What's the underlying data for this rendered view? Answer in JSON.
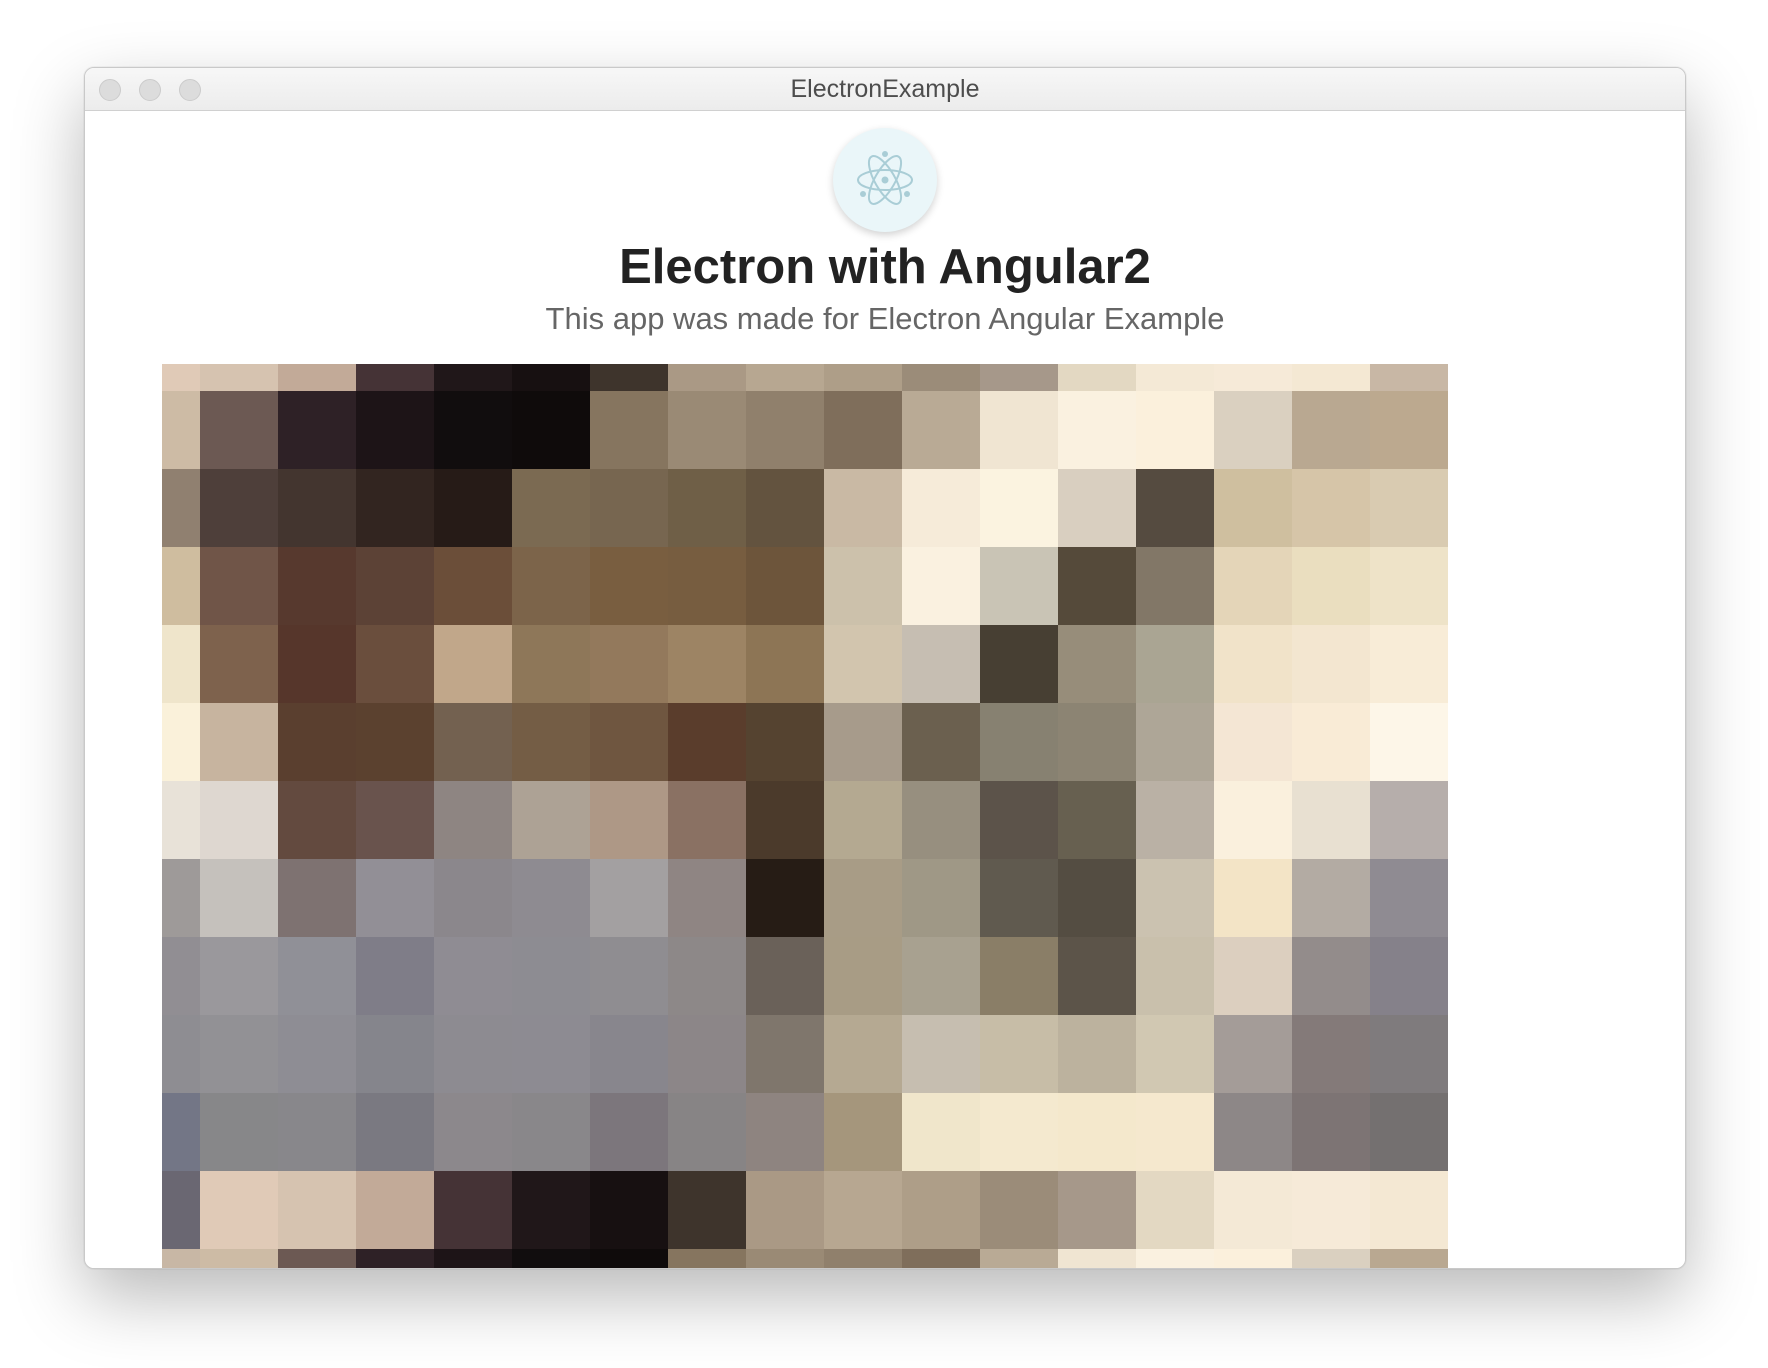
{
  "window": {
    "title": "ElectronExample"
  },
  "header": {
    "logo_icon": "electron-atom-icon",
    "title": "Electron with Angular2",
    "subtitle": "This app was made for Electron Angular Example"
  },
  "photo": {
    "description_icon": "pixelated-image",
    "palette": [
      "#e0cab7",
      "#d6c3b0",
      "#c2aa98",
      "#453336",
      "#201719",
      "#171011",
      "#3e342c",
      "#aa9985",
      "#b7a791",
      "#ae9e88",
      "#9b8c79",
      "#a6988a",
      "#e3d8c2",
      "#f4e9d6",
      "#f6ead8",
      "#f4e8d3",
      "#c8b7a5",
      "#cdbba5",
      "#6c5953",
      "#2e2126",
      "#1d1417",
      "#110d0e",
      "#0f0b0b",
      "#86755f",
      "#9a8a75",
      "#90806c",
      "#7f6e5b",
      "#b9aa95",
      "#f0e5d2",
      "#faf1e0",
      "#fbf0dc",
      "#dad0c0",
      "#b9a891",
      "#bca98f",
      "#908070",
      "#4e3f3a",
      "#43352f",
      "#322520",
      "#261b17",
      "#7b6a52",
      "#776650",
      "#6f5f47",
      "#63533f",
      "#c9b9a4",
      "#f6ebd9",
      "#fbf3e0",
      "#d9cfc0",
      "#554b40",
      "#cfbf9f",
      "#d6c5a8",
      "#d9cbb1",
      "#cfbd9f",
      "#705548",
      "#57392e",
      "#5c4236",
      "#6b4e39",
      "#7c644a",
      "#795e40",
      "#775d40",
      "#6d553b",
      "#ccc1ab",
      "#faf1e0",
      "#c9c4b5",
      "#554a3a",
      "#827767",
      "#e4d5b8",
      "#eadebf",
      "#eee3c8",
      "#efe5cb",
      "#7e624d",
      "#56362b",
      "#6a4e3d",
      "#c1a78a",
      "#8e7759",
      "#93795c",
      "#9d8464",
      "#8d7555",
      "#d2c5ae",
      "#c6beb2",
      "#473f33",
      "#978d7a",
      "#aaa593",
      "#f1e3c9",
      "#f3e6d0",
      "#f8ecd7",
      "#faf1da",
      "#c7b49f",
      "#5a3f2f",
      "#5b412f",
      "#736150",
      "#745d45",
      "#6f5640",
      "#5a3d2c",
      "#554330",
      "#a79b8b",
      "#6b604f",
      "#878171",
      "#8c8473",
      "#aea697",
      "#f4e6d4",
      "#f9ebd6",
      "#fdf6e8",
      "#e8e2d8",
      "#ded7d0",
      "#634a3f",
      "#69534d",
      "#8e8582",
      "#ada295",
      "#ae9886",
      "#8a7163",
      "#4b3a2b",
      "#b4a991",
      "#978f7f",
      "#5c534a",
      "#676050",
      "#bab1a5",
      "#faf0dd",
      "#e8e0d1",
      "#b6aeab",
      "#9e9a99",
      "#c5c1bc",
      "#7e7271",
      "#928f96",
      "#8b878c",
      "#8e8b91",
      "#a3a0a1",
      "#8f8583",
      "#261c15",
      "#a89c86",
      "#9f9886",
      "#605a4f",
      "#544d42",
      "#cbc2b0",
      "#f3e4c6",
      "#b3aba3",
      "#8f8b92",
      "#918e93",
      "#9a989c",
      "#909097",
      "#7f7d88",
      "#8f8c93",
      "#8d8c92",
      "#8f8d91",
      "#8d8888",
      "#6a6159",
      "#a89c85",
      "#a8a190",
      "#8a7e67",
      "#5c5449",
      "#c9c0ac",
      "#dccfbf",
      "#938c8b",
      "#85818a",
      "#8e8d92",
      "#929195",
      "#8e8d94",
      "#85858c",
      "#8d8b91",
      "#8d8b92",
      "#88868d",
      "#8c8688",
      "#7f766c",
      "#b5a992",
      "#c6beb0",
      "#c7bda7",
      "#bcb29e",
      "#d1c8b2",
      "#a49c98",
      "#847a79",
      "#7f7b7d",
      "#737686",
      "#878789",
      "#88878b",
      "#7a7981",
      "#8c888c",
      "#89878a",
      "#7c767c",
      "#878485",
      "#8e8480",
      "#a5967c",
      "#f0e6cb",
      "#f4e9cf",
      "#f4e8cc",
      "#f5e8ce",
      "#8d8787",
      "#7d7474",
      "#747070",
      "#6a6772"
    ]
  }
}
